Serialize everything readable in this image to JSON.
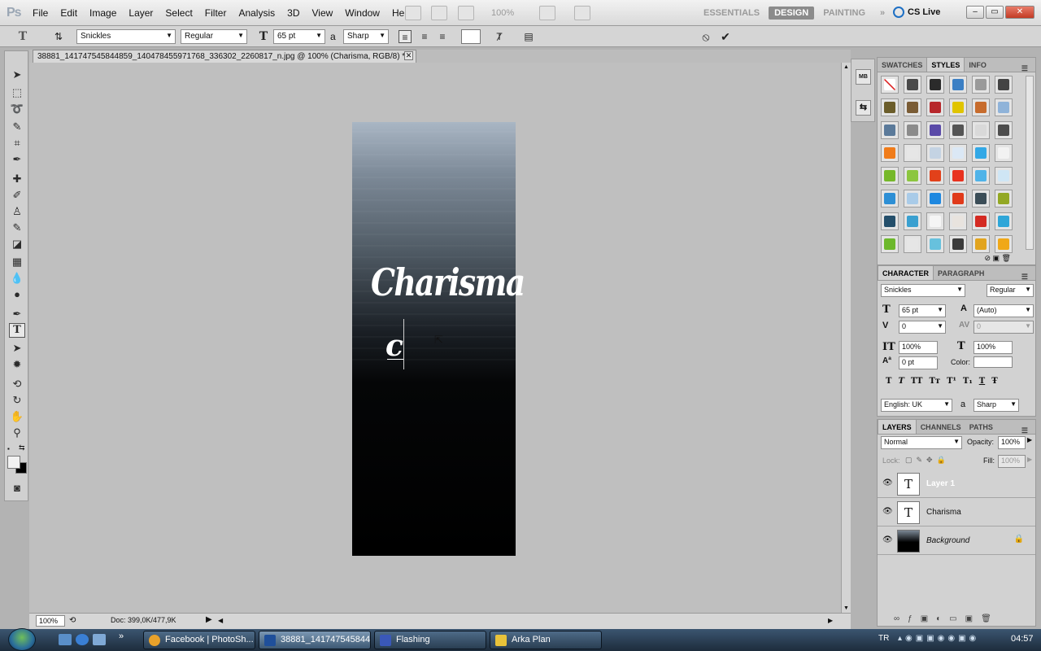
{
  "app": {
    "logo": "Ps",
    "menus": [
      "File",
      "Edit",
      "Image",
      "Layer",
      "Select",
      "Filter",
      "Analysis",
      "3D",
      "View",
      "Window",
      "Help"
    ],
    "zoom_dropdown": "100%",
    "workspaces": [
      "ESSENTIALS",
      "DESIGN",
      "PAINTING"
    ],
    "active_workspace": "DESIGN",
    "more_workspaces": "»",
    "cs_live": "CS Live"
  },
  "options_bar": {
    "font_family": "Snickles",
    "font_style": "Regular",
    "font_size": "65 pt",
    "antialias_label": "a",
    "antialias": "Sharp"
  },
  "document": {
    "tab_title": "38881_141747545844859_140478455971768_336302_2260817_n.jpg @ 100% (Charisma, RGB/8) *",
    "canvas_title": "Charisma",
    "typing_text": "c",
    "zoom": "100%",
    "doc_info": "Doc: 399,0K/477,9K"
  },
  "mini_dock": [
    "MB",
    "⇆"
  ],
  "styles_panel": {
    "tabs": [
      "SWATCHES",
      "STYLES",
      "INFO"
    ],
    "active_tab": "STYLES",
    "swatch_colors": [
      "#ffffff",
      "#4a4a4a",
      "#2b2b2b",
      "#3b7fc4",
      "#9a9a9a",
      "#444444",
      "#6b5d2a",
      "#7a5c35",
      "#b7272b",
      "#e0c400",
      "#c76c2d",
      "#8fb3d9",
      "#5b7a9a",
      "#8b8b8b",
      "#5a4aa8",
      "#555555",
      "#d9d9d9",
      "#4d4d4d",
      "#f07c1a",
      "#e6e6e6",
      "#c4d3e3",
      "#dbe8f5",
      "#33a8e6",
      "#f2f2f2",
      "#76b82a",
      "#8cc63f",
      "#e2411a",
      "#e8321f",
      "#4fb3e8",
      "#cfe6f5",
      "#2d8fd5",
      "#a9cbe8",
      "#1e88e0",
      "#e03a1a",
      "#3b4d57",
      "#93a823",
      "#244f6b",
      "#3aa0d0",
      "#f5f5f5",
      "#e8e3de",
      "#d42a22",
      "#2ea6d8",
      "#6cb82b",
      "#e6e6e6",
      "#67c1dd",
      "#3b3b3b",
      "#e2a41e",
      "#f0a818"
    ]
  },
  "character_panel": {
    "tabs": [
      "CHARACTER",
      "PARAGRAPH"
    ],
    "font_family": "Snickles",
    "font_style": "Regular",
    "size": "65 pt",
    "leading": "(Auto)",
    "kerning": "0",
    "tracking": "0",
    "vertical_scale": "100%",
    "horizontal_scale": "100%",
    "baseline_shift": "0 pt",
    "color_label": "Color:",
    "style_buttons": [
      "T",
      "T",
      "TT",
      "Tт",
      "T¹",
      "T₁",
      "T",
      "Ŧ"
    ],
    "language": "English: UK",
    "antialias_label": "a",
    "antialias": "Sharp"
  },
  "layers_panel": {
    "tabs": [
      "LAYERS",
      "CHANNELS",
      "PATHS"
    ],
    "blend_mode": "Normal",
    "opacity_label": "Opacity:",
    "opacity": "100%",
    "lock_label": "Lock:",
    "fill_label": "Fill:",
    "fill": "100%",
    "layers": [
      {
        "name": "Layer 1",
        "type": "text",
        "selected": true
      },
      {
        "name": "Charisma",
        "type": "text",
        "selected": false
      },
      {
        "name": "Background",
        "type": "image",
        "selected": false,
        "locked": true
      }
    ]
  },
  "taskbar": {
    "tasks": [
      {
        "label": "Facebook | PhotoSh...",
        "icon_color": "#e8a12a"
      },
      {
        "label": "38881_141747545844...",
        "icon_color": "#1f4f9a",
        "active": true
      },
      {
        "label": "Flashing",
        "icon_color": "#3a58b8"
      },
      {
        "label": "Arka Plan",
        "icon_color": "#e8c23a"
      }
    ],
    "language": "TR",
    "clock": "04:57"
  }
}
